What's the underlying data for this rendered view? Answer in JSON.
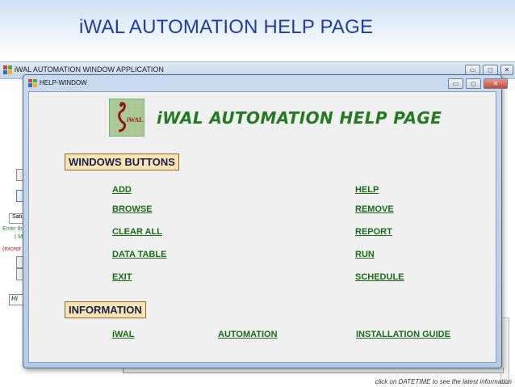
{
  "slide": {
    "title": "iWAL AUTOMATION HELP PAGE"
  },
  "app_window": {
    "title": "iWAL AUTOMATION WINDOW APPLICATION",
    "controls": {
      "minimize": "▭",
      "maximize": "◻",
      "close": "✕"
    },
    "left_panel": {
      "combo_text": "Satu",
      "green_text_1": "Enter th",
      "green_text_2": "( M",
      "red_text": "(except",
      "history_text": "Hi"
    },
    "status_note": "click on DATETIME to see the latest information"
  },
  "help_window": {
    "title": "HELP-WINDOW",
    "controls": {
      "minimize": "▭",
      "maximize": "◻",
      "close": "✕"
    },
    "logo_text": "iWAL",
    "header": "iWAL AUTOMATION HELP PAGE",
    "sections": {
      "windows_buttons": {
        "label": "WINDOWS BUTTONS",
        "left_links": [
          "ADD",
          "BROWSE",
          "CLEAR ALL",
          "DATA TABLE",
          "EXIT"
        ],
        "right_links": [
          "HELP",
          "REMOVE",
          "REPORT",
          "RUN",
          "SCHEDULE"
        ]
      },
      "information": {
        "label": "INFORMATION",
        "links": [
          "iWAL",
          "AUTOMATION",
          "INSTALLATION GUIDE"
        ]
      }
    }
  },
  "colors": {
    "slide_title": "#1f3f9a",
    "link_green": "#1a6a1a",
    "header_green": "#237a23",
    "section_bg": "#fbe4b4"
  }
}
